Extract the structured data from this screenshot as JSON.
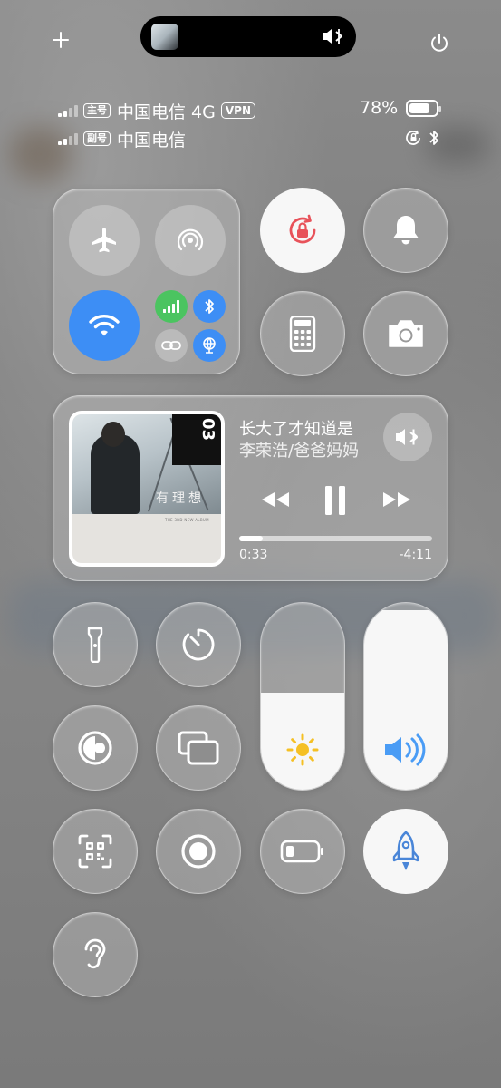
{
  "statusbar": {
    "sim1_badge": "主号",
    "sim1_carrier": "中国电信 4G",
    "vpn": "VPN",
    "sim2_badge": "副号",
    "sim2_carrier": "中国电信",
    "battery_percent": "78%",
    "battery_level": 0.78
  },
  "icons": {
    "top": [
      "plus-icon",
      "power-icon"
    ],
    "dynamic_island": [
      "album-thumb",
      "speaker-bluetooth-icon"
    ],
    "status": [
      "rotation-lock-icon",
      "bluetooth-icon"
    ],
    "connectivity": [
      "airplane-mode-icon",
      "airdrop-icon",
      "wifi-icon",
      "cellular-data-icon",
      "bluetooth-icon",
      "link-icon",
      "network-globe-icon"
    ],
    "top_right": [
      "rotation-lock-icon",
      "bell-icon",
      "calculator-icon",
      "camera-icon"
    ],
    "bottom": [
      "flashlight-icon",
      "timer-icon",
      "color-filter-icon",
      "screen-mirroring-icon",
      "qr-scanner-icon",
      "screen-record-icon",
      "low-power-icon",
      "rocket-icon",
      "hearing-icon",
      "brightness-icon",
      "volume-icon"
    ]
  },
  "colors": {
    "accent_blue": "#3d8ef5",
    "cellular_green": "#4bc460",
    "rotation_lock_red": "#e8525a",
    "brightness_yellow": "#f5c024",
    "volume_blue": "#4a9cf5"
  },
  "media": {
    "title": "长大了才知道是",
    "artist": "李荣浩/爸爸妈妈",
    "elapsed": "0:33",
    "remaining": "-4:11",
    "progress": 0.12,
    "album": {
      "number": "03",
      "title": "有理想",
      "subtitle": "THE 3RD NEW ALBUM"
    }
  },
  "sliders": {
    "brightness_level": 0.52,
    "volume_level": 0.96
  }
}
